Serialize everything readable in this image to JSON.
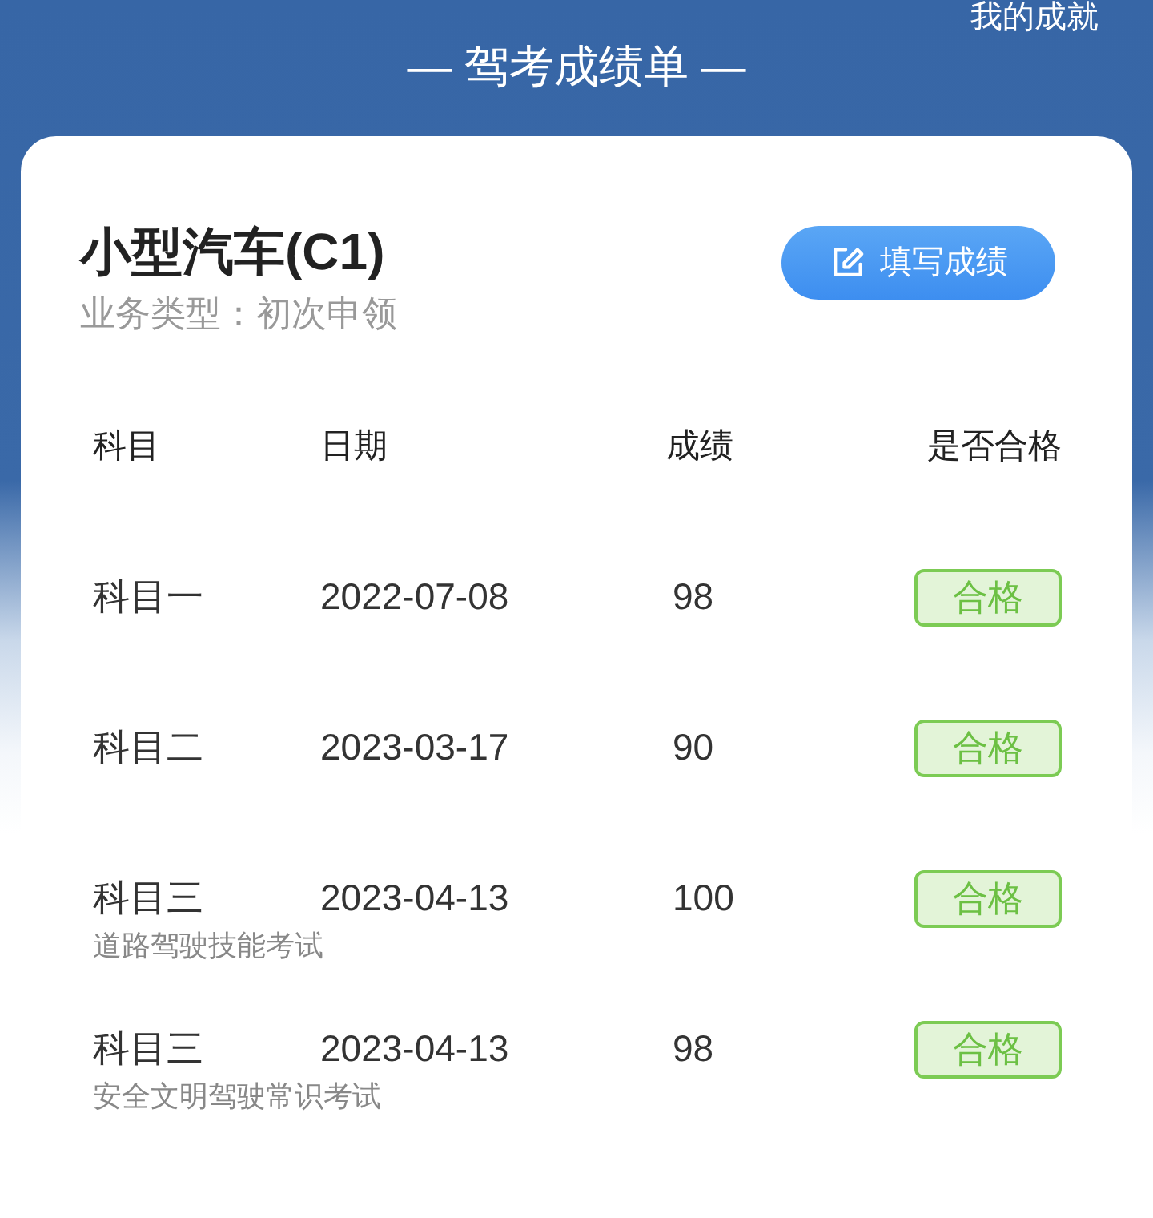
{
  "top_link": "我的成就",
  "page_title": "— 驾考成绩单 —",
  "card": {
    "title": "小型汽车(C1)",
    "subtitle": "业务类型：初次申领",
    "fill_button": "填写成绩"
  },
  "table": {
    "columns": [
      "科目",
      "日期",
      "成绩",
      "是否合格"
    ],
    "rows": [
      {
        "subject": "科目一",
        "date": "2022-07-08",
        "score": "98",
        "result": "合格",
        "passed": true
      },
      {
        "subject": "科目二",
        "date": "2023-03-17",
        "score": "90",
        "result": "合格",
        "passed": true
      },
      {
        "subject": "科目三",
        "date": "2023-04-13",
        "score": "100",
        "result": "合格",
        "passed": true,
        "note": "道路驾驶技能考试"
      },
      {
        "subject": "科目三",
        "date": "2023-04-13",
        "score": "98",
        "result": "合格",
        "passed": true,
        "note": "安全文明驾驶常识考试"
      }
    ]
  }
}
